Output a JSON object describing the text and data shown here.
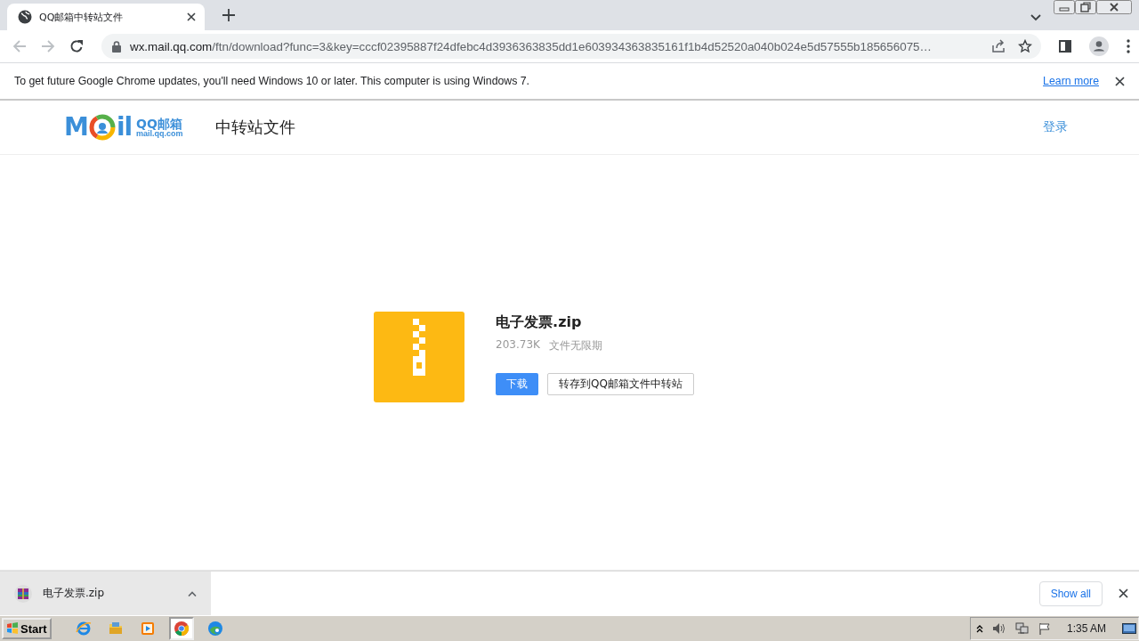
{
  "browser": {
    "tab": {
      "title": "QQ邮箱中转站文件"
    },
    "address": {
      "host": "wx.mail.qq.com",
      "path": "/ftn/download?func=3&key=cccf02395887f24dfebc4d3936363835dd1e603934363835161f1b4d52520a040b024e5d57555b185656075…"
    }
  },
  "infobar": {
    "message": "To get future Google Chrome updates, you'll need Windows 10 or later. This computer is using Windows 7.",
    "link": "Learn more"
  },
  "page": {
    "logo": {
      "left": "M",
      "right": "il",
      "name": "QQ邮箱",
      "domain": "mail.qq.com"
    },
    "title": "中转站文件",
    "login": "登录"
  },
  "file": {
    "name": "电子发票.zip",
    "size": "203.73K",
    "expiry": "文件无限期",
    "buttons": [
      {
        "label": "下载",
        "kind": "primary"
      },
      {
        "label": "转存到QQ邮箱文件中转站",
        "kind": "secondary"
      }
    ]
  },
  "downloads": {
    "items": [
      {
        "name": "电子发票.zip"
      }
    ],
    "show_all": "Show all"
  },
  "taskbar": {
    "start": "Start",
    "apps": [
      {
        "kind": "ie",
        "selected": false
      },
      {
        "kind": "folder",
        "selected": false
      },
      {
        "kind": "media",
        "selected": false
      },
      {
        "kind": "chrome",
        "selected": true
      },
      {
        "kind": "edge",
        "selected": false
      }
    ],
    "clock": "1:35 AM"
  }
}
